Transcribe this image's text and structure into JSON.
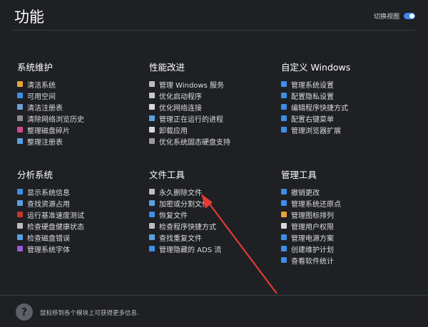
{
  "window": {
    "title": "功能"
  },
  "view_toggle": {
    "label": "切换视图",
    "state": "on",
    "accent_color": "#3a86f5"
  },
  "sections": [
    {
      "id": "maintenance",
      "title": "系统维护",
      "items": [
        {
          "label": "清洁系统",
          "icon": "broom-icon",
          "color": "#e8a33c"
        },
        {
          "label": "可用空间",
          "icon": "disk-space-icon",
          "color": "#3d8ee8"
        },
        {
          "label": "清洁注册表",
          "icon": "registry-clean-icon",
          "color": "#6fa0d8"
        },
        {
          "label": "清除网络浏览历史",
          "icon": "globe-icon",
          "color": "#8a8a8a"
        },
        {
          "label": "整理磁盘碎片",
          "icon": "defrag-icon",
          "color": "#d04a8e"
        },
        {
          "label": "整理注册表",
          "icon": "registry-defrag-icon",
          "color": "#5aa0e0"
        }
      ]
    },
    {
      "id": "performance",
      "title": "性能改进",
      "items": [
        {
          "label": "管理 Windows 服务",
          "icon": "gear-icon",
          "color": "#bdbdbd"
        },
        {
          "label": "优化启动程序",
          "icon": "rocket-icon",
          "color": "#c8c8c8"
        },
        {
          "label": "优化网络连接",
          "icon": "network-icon",
          "color": "#d8d8d8"
        },
        {
          "label": "管理正在运行的进程",
          "icon": "process-icon",
          "color": "#5aa0e0"
        },
        {
          "label": "卸载应用",
          "icon": "uninstall-icon",
          "color": "#d8d8d8"
        },
        {
          "label": "优化系统固态硬盘支持",
          "icon": "ssd-icon",
          "color": "#9a9a9a"
        }
      ]
    },
    {
      "id": "customize",
      "title": "自定义 Windows",
      "items": [
        {
          "label": "管理系统设置",
          "icon": "settings-panel-icon",
          "color": "#3d8ee8"
        },
        {
          "label": "配置隐私设置",
          "icon": "privacy-icon",
          "color": "#3d8ee8"
        },
        {
          "label": "编辑程序快捷方式",
          "icon": "shortcut-icon",
          "color": "#3d8ee8"
        },
        {
          "label": "配置右键菜单",
          "icon": "context-menu-icon",
          "color": "#3d8ee8"
        },
        {
          "label": "管理浏览器扩展",
          "icon": "extension-icon",
          "color": "#3d8ee8"
        }
      ]
    },
    {
      "id": "analysis",
      "title": "分析系统",
      "items": [
        {
          "label": "显示系统信息",
          "icon": "system-info-icon",
          "color": "#3d8ee8"
        },
        {
          "label": "查找资源占用",
          "icon": "resource-icon",
          "color": "#5aa0e0"
        },
        {
          "label": "运行基准速度测试",
          "icon": "benchmark-icon",
          "color": "#c0392b"
        },
        {
          "label": "检查硬盘健康状态",
          "icon": "disk-health-icon",
          "color": "#bdbdbd"
        },
        {
          "label": "检查磁盘错误",
          "icon": "disk-check-icon",
          "color": "#5aa0e0"
        },
        {
          "label": "管理系统字体",
          "icon": "font-icon",
          "color": "#9b59d0"
        }
      ]
    },
    {
      "id": "files",
      "title": "文件工具",
      "items": [
        {
          "label": "永久删除文件",
          "icon": "shred-icon",
          "color": "#bdbdbd"
        },
        {
          "label": "加密或分割文件",
          "icon": "encrypt-file-icon",
          "color": "#5aa0e0"
        },
        {
          "label": "恢复文件",
          "icon": "recover-icon",
          "color": "#3d8ee8"
        },
        {
          "label": "检查程序快捷方式",
          "icon": "link-icon",
          "color": "#bdbdbd"
        },
        {
          "label": "查找重复文件",
          "icon": "duplicate-icon",
          "color": "#5aa0e0"
        },
        {
          "label": "管理隐藏的 ADS 流",
          "icon": "ads-icon",
          "color": "#3d8ee8"
        }
      ]
    },
    {
      "id": "admin",
      "title": "管理工具",
      "items": [
        {
          "label": "撤销更改",
          "icon": "undo-icon",
          "color": "#3d8ee8"
        },
        {
          "label": "管理系统还原点",
          "icon": "restore-point-icon",
          "color": "#3d8ee8"
        },
        {
          "label": "管理图标排列",
          "icon": "icon-layout-icon",
          "color": "#e8a33c"
        },
        {
          "label": "管理用户权限",
          "icon": "user-icon",
          "color": "#d8d8d8"
        },
        {
          "label": "管理电源方案",
          "icon": "power-icon",
          "color": "#3d8ee8"
        },
        {
          "label": "创建维护计划",
          "icon": "calendar-icon",
          "color": "#3d8ee8"
        },
        {
          "label": "查看软件统计",
          "icon": "stats-icon",
          "color": "#3d8ee8"
        }
      ]
    }
  ],
  "footer": {
    "help_icon": "?",
    "hint": "鼠标移到各个模块上可获得更多信息."
  },
  "annotation": {
    "icon": "red-arrow-icon",
    "color": "#e53935"
  }
}
